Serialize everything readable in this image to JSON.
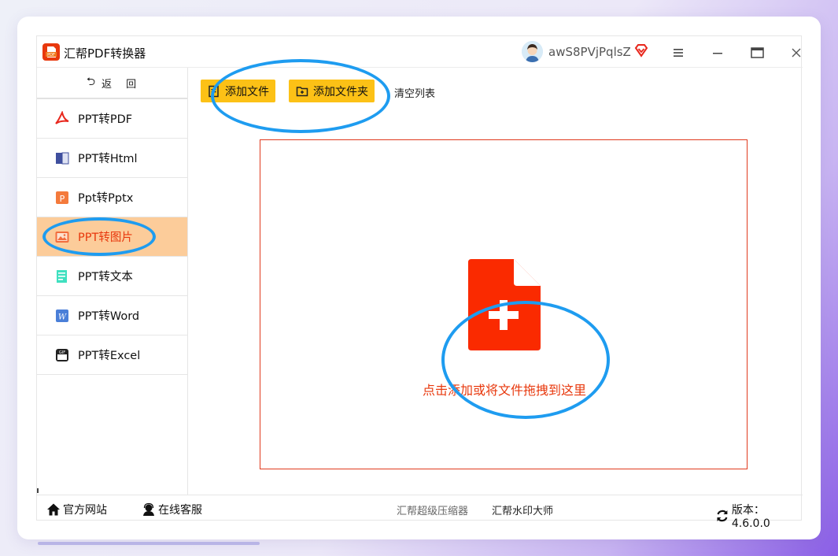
{
  "window": {
    "title": "汇帮PDF转换器",
    "username": "awS8PVjPqlsZ",
    "icons": [
      "app-logo-icon",
      "avatar",
      "vip-diamond-icon",
      "menu-icon",
      "minimize-icon",
      "maximize-icon",
      "close-icon"
    ]
  },
  "sidebar": {
    "back_label": "返 回",
    "items": [
      {
        "label": "PPT转PDF",
        "icon": "pdf-icon",
        "active": false
      },
      {
        "label": "PPT转Html",
        "icon": "html-icon",
        "active": false
      },
      {
        "label": "Ppt转Pptx",
        "icon": "pptx-icon",
        "active": false
      },
      {
        "label": "PPT转图片",
        "icon": "image-icon",
        "active": true
      },
      {
        "label": "PPT转文本",
        "icon": "text-icon",
        "active": false
      },
      {
        "label": "PPT转Word",
        "icon": "word-icon",
        "active": false
      },
      {
        "label": "PPT转Excel",
        "icon": "excel-icon",
        "active": false
      }
    ]
  },
  "toolbar": {
    "add_file": "添加文件",
    "add_folder": "添加文件夹",
    "clear_list": "清空列表"
  },
  "dropzone": {
    "hint": "点击添加或将文件拖拽到这里"
  },
  "footer": {
    "website": "官方网站",
    "support": "在线客服",
    "link_compressor": "汇帮超级压缩器",
    "link_watermark": "汇帮水印大师",
    "version": "版本：4.6.0.0"
  },
  "colors": {
    "accent_red": "#e8380d",
    "button_yellow": "#fcc116",
    "active_bg": "#fccc9a",
    "annotation_blue": "#1e9cf0"
  }
}
